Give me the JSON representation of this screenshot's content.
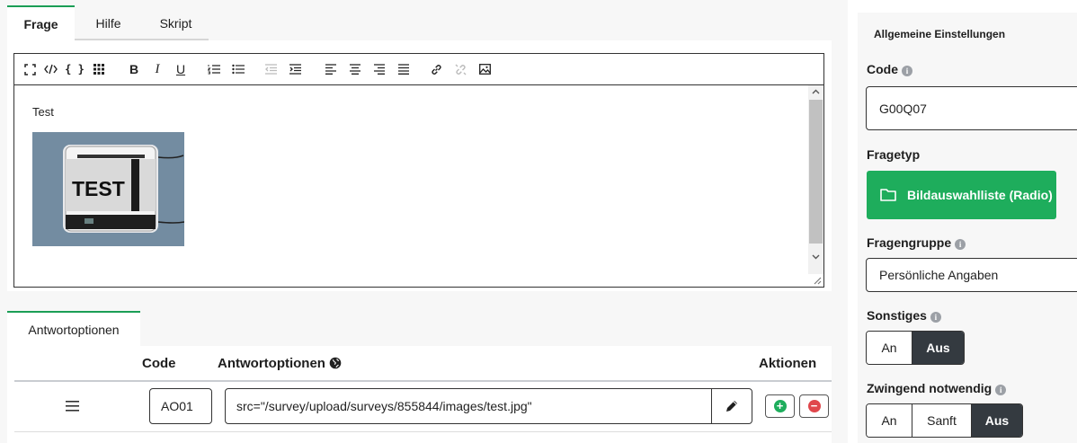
{
  "tabs": [
    {
      "label": "Frage"
    },
    {
      "label": "Hilfe"
    },
    {
      "label": "Skript"
    }
  ],
  "editor": {
    "text": "Test",
    "image_label": "TEST"
  },
  "answers": {
    "tab_label": "Antwortoptionen",
    "col_code": "Code",
    "col_options": "Antwortoptionen",
    "col_actions": "Aktionen",
    "rows": [
      {
        "code": "AO01",
        "value": "src=\"/survey/upload/surveys/855844/images/test.jpg\""
      }
    ]
  },
  "settings": {
    "header": "Allgemeine Einstellungen",
    "code_label": "Code",
    "code_value": "G00Q07",
    "type_label": "Fragetyp",
    "type_value": "Bildauswahlliste (Radio)",
    "group_label": "Fragengruppe",
    "group_value": "Persönliche Angaben",
    "other_label": "Sonstiges",
    "other_options": [
      "An",
      "Aus"
    ],
    "other_selected": "Aus",
    "mandatory_label": "Zwingend notwendig",
    "mandatory_options": [
      "An",
      "Sanft",
      "Aus"
    ],
    "mandatory_selected": "Aus"
  },
  "colors": {
    "accent": "#1b9e56",
    "type_button": "#1ead5c",
    "selected_segment": "#343a40",
    "add": "#1ead5c",
    "remove": "#e0474c"
  }
}
